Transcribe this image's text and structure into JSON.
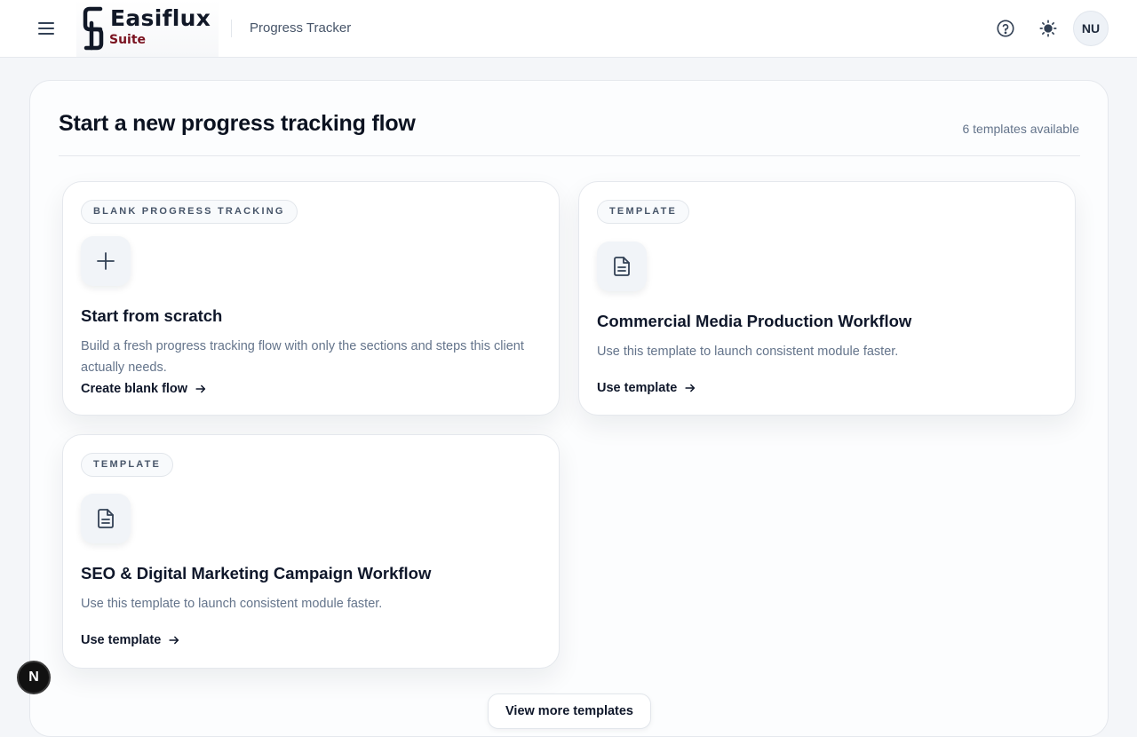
{
  "header": {
    "logo_name": "Easiflux",
    "logo_suite": "Suite",
    "app_title": "Progress Tracker",
    "avatar_initials": "NU",
    "icons": [
      "menu-icon",
      "help-icon",
      "sun-icon"
    ]
  },
  "main": {
    "title": "Start a new progress tracking flow",
    "template_count": "6 templates available",
    "view_more_label": "View more templates",
    "cards": [
      {
        "badge": "BLANK PROGRESS TRACKING",
        "icon": "plus-icon",
        "title": "Start from scratch",
        "description": "Build a fresh progress tracking flow with only the sections and steps this client actually needs.",
        "action": "Create blank flow"
      },
      {
        "badge": "TEMPLATE",
        "icon": "document-icon",
        "title": "Commercial Media Production Workflow",
        "description": "Use this template to launch consistent module faster.",
        "action": "Use template"
      },
      {
        "badge": "TEMPLATE",
        "icon": "document-icon",
        "title": "SEO & Digital Marketing Campaign Workflow",
        "description": "Use this template to launch consistent module faster.",
        "action": "Use template"
      }
    ]
  },
  "floating_badge": "N",
  "colors": {
    "brand_accent": "#7a1220",
    "text_primary": "#0f172a",
    "text_muted": "#64748b",
    "background": "#f4f6f9"
  }
}
